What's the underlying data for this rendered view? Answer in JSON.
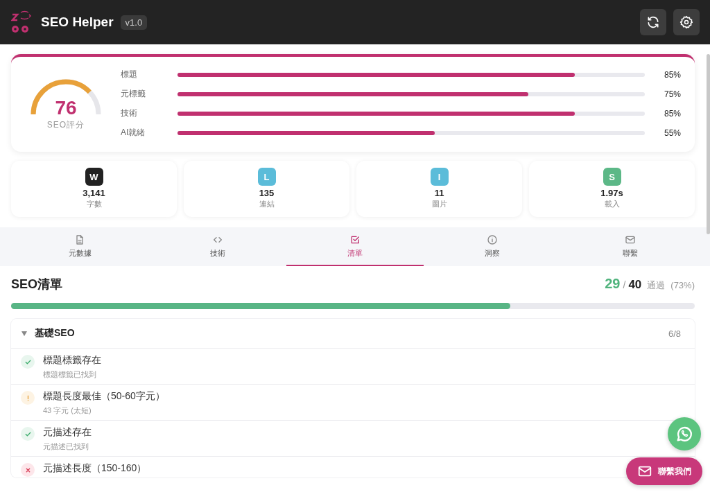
{
  "app": {
    "title": "SEO Helper",
    "version": "v1.0"
  },
  "score": {
    "value": "76",
    "label": "SEO評分",
    "bars": [
      {
        "label": "標題",
        "level": 0.85,
        "reading": "85%"
      },
      {
        "label": "元標籤",
        "level": 0.75,
        "reading": "75%"
      },
      {
        "label": "技術",
        "level": 0.85,
        "reading": "85%"
      },
      {
        "label": "AI就緒",
        "level": 0.55,
        "reading": "55%"
      }
    ]
  },
  "stats": [
    {
      "badge": "W",
      "color": "#222222",
      "value": "3,141",
      "label": "字數"
    },
    {
      "badge": "L",
      "color": "#5bbcd9",
      "value": "135",
      "label": "連結"
    },
    {
      "badge": "I",
      "color": "#5bbcd9",
      "value": "11",
      "label": "圖片"
    },
    {
      "badge": "S",
      "color": "#5cb887",
      "value": "1.97s",
      "label": "載入"
    }
  ],
  "tabs": [
    {
      "label": "元數據",
      "selected": false
    },
    {
      "label": "技術",
      "selected": false
    },
    {
      "label": "清單",
      "selected": true
    },
    {
      "label": "洞察",
      "selected": false
    },
    {
      "label": "聯繫",
      "selected": false
    }
  ],
  "checklist": {
    "title": "SEO清單",
    "passed": "29",
    "separator": "/",
    "total": "40",
    "passed_label": "通過",
    "percent": "(73%)",
    "level": 0.73,
    "sections": [
      {
        "title": "基礎SEO",
        "count": "6/8",
        "expanded": true,
        "items": [
          {
            "title": "標題標籤存在",
            "detail": "標題標籤已找到",
            "kind": "pass"
          },
          {
            "title": "標題長度最佳（50-60字元）",
            "detail": "43 字元 (太短)",
            "kind": "warn"
          },
          {
            "title": "元描述存在",
            "detail": "元描述已找到",
            "kind": "pass"
          },
          {
            "title": "元描述長度（150-160）",
            "kind": "fail"
          }
        ]
      }
    ]
  },
  "floating": {
    "contact": "聯繫我們"
  }
}
